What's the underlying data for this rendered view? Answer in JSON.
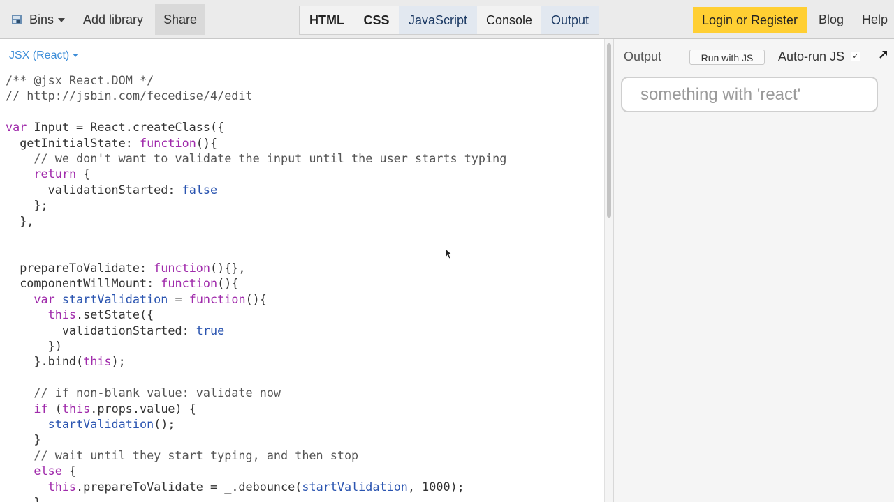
{
  "toolbar": {
    "bins_label": "Bins",
    "add_library_label": "Add library",
    "share_label": "Share",
    "panels": [
      {
        "label": "HTML",
        "bold": true,
        "active": false
      },
      {
        "label": "CSS",
        "bold": true,
        "active": false
      },
      {
        "label": "JavaScript",
        "bold": false,
        "active": true
      },
      {
        "label": "Console",
        "bold": false,
        "active": false
      },
      {
        "label": "Output",
        "bold": false,
        "active": true
      }
    ],
    "login_label": "Login or Register",
    "blog_label": "Blog",
    "help_label": "Help"
  },
  "editor": {
    "language_label": "JSX (React)",
    "code_lines": [
      [
        [
          "cm",
          "/** @jsx React.DOM */"
        ]
      ],
      [
        [
          "cm",
          "// http://jsbin.com/fecedise/4/edit"
        ]
      ],
      [],
      [
        [
          "kw",
          "var"
        ],
        [
          "",
          " Input = React.createClass({"
        ]
      ],
      [
        [
          "",
          "  getInitialState: "
        ],
        [
          "kw",
          "function"
        ],
        [
          "",
          "(){"
        ]
      ],
      [
        [
          "cm",
          "    // we don't want to validate the input until the user starts typing"
        ]
      ],
      [
        [
          "",
          "    "
        ],
        [
          "kw",
          "return"
        ],
        [
          "",
          " {"
        ]
      ],
      [
        [
          "",
          "      validationStarted: "
        ],
        [
          "atom",
          "false"
        ]
      ],
      [
        [
          "",
          "    };"
        ]
      ],
      [
        [
          "",
          "  },"
        ]
      ],
      [],
      [],
      [
        [
          "",
          "  prepareToValidate: "
        ],
        [
          "kw",
          "function"
        ],
        [
          "",
          "(){},"
        ]
      ],
      [
        [
          "",
          "  componentWillMount: "
        ],
        [
          "kw",
          "function"
        ],
        [
          "",
          "(){"
        ]
      ],
      [
        [
          "",
          "    "
        ],
        [
          "kw",
          "var"
        ],
        [
          "",
          " "
        ],
        [
          "def",
          "startValidation"
        ],
        [
          "",
          " = "
        ],
        [
          "kw",
          "function"
        ],
        [
          "",
          "(){"
        ]
      ],
      [
        [
          "",
          "      "
        ],
        [
          "kw",
          "this"
        ],
        [
          "",
          ".setState({"
        ]
      ],
      [
        [
          "",
          "        validationStarted: "
        ],
        [
          "atom",
          "true"
        ]
      ],
      [
        [
          "",
          "      })"
        ]
      ],
      [
        [
          "",
          "    }.bind("
        ],
        [
          "kw",
          "this"
        ],
        [
          "",
          ");"
        ]
      ],
      [],
      [
        [
          "cm",
          "    // if non-blank value: validate now"
        ]
      ],
      [
        [
          "",
          "    "
        ],
        [
          "kw",
          "if"
        ],
        [
          "",
          " ("
        ],
        [
          "kw",
          "this"
        ],
        [
          "",
          ".props.value) {"
        ]
      ],
      [
        [
          "",
          "      "
        ],
        [
          "def",
          "startValidation"
        ],
        [
          "",
          "();"
        ]
      ],
      [
        [
          "",
          "    }"
        ]
      ],
      [
        [
          "cm",
          "    // wait until they start typing, and then stop"
        ]
      ],
      [
        [
          "",
          "    "
        ],
        [
          "kw",
          "else"
        ],
        [
          "",
          " {"
        ]
      ],
      [
        [
          "",
          "      "
        ],
        [
          "kw",
          "this"
        ],
        [
          "",
          ".prepareToValidate = _.debounce("
        ],
        [
          "def",
          "startValidation"
        ],
        [
          "",
          ", "
        ],
        [
          "num",
          "1000"
        ],
        [
          "",
          ");"
        ]
      ],
      [
        [
          "",
          "    }"
        ]
      ]
    ]
  },
  "output": {
    "label": "Output",
    "run_label": "Run with JS",
    "autorun_label": "Auto-run JS",
    "autorun_checked": "✓",
    "popout_icon": "arrow-up-right-icon",
    "input_placeholder": "something with 'react'"
  },
  "colors": {
    "toolbar_bg": "#ebebeb",
    "login_bg": "#ffcf33",
    "keyword": "#a02bab",
    "definition": "#2a54b0",
    "language_label": "#3c8dd8"
  }
}
